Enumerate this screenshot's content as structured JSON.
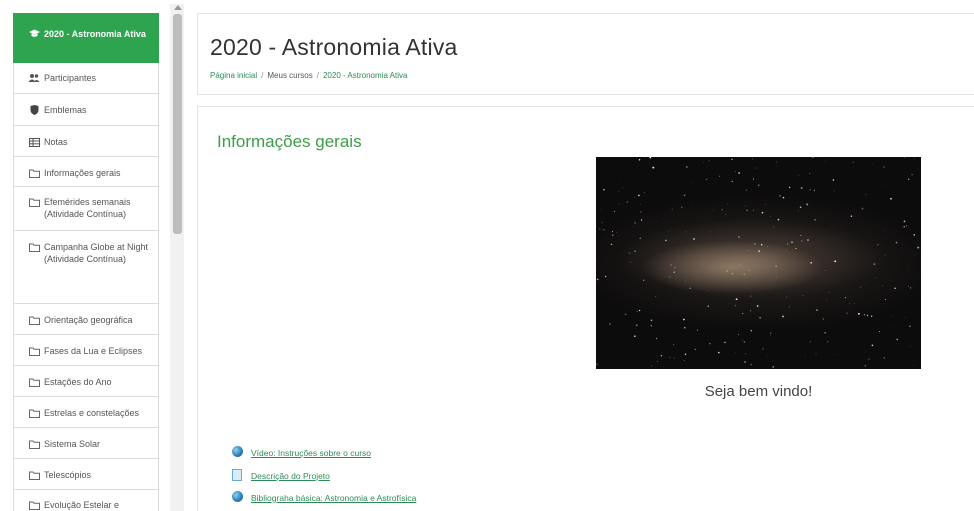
{
  "sidebar": {
    "items": [
      {
        "label": "2020 - Astronomia Ativa",
        "icon": "graduation-cap-icon",
        "active": true
      },
      {
        "label": "Participantes",
        "icon": "users-icon"
      },
      {
        "label": "Emblemas",
        "icon": "shield-icon"
      },
      {
        "label": "Notas",
        "icon": "table-icon"
      },
      {
        "label": "Informações gerais",
        "icon": "folder-icon"
      },
      {
        "label": "Efemérides semanais (Atividade Contínua)",
        "icon": "folder-icon"
      },
      {
        "label": "Campanha Globe at Night (Atividade Contínua)",
        "icon": "folder-icon"
      },
      {
        "label": "Orientação geográfica",
        "icon": "folder-icon"
      },
      {
        "label": "Fases da Lua e Eclipses",
        "icon": "folder-icon"
      },
      {
        "label": "Estações do Ano",
        "icon": "folder-icon"
      },
      {
        "label": "Estrelas e constelações",
        "icon": "folder-icon"
      },
      {
        "label": "Sistema Solar",
        "icon": "folder-icon"
      },
      {
        "label": "Telescópios",
        "icon": "folder-icon"
      },
      {
        "label": "Evolução Estelar e Objetos de Céu",
        "icon": "folder-icon"
      }
    ]
  },
  "header": {
    "title": "2020 - Astronomia Ativa",
    "breadcrumb": [
      "Página inicial",
      "Meus cursos",
      "2020 - Astronomia Ativa"
    ]
  },
  "main": {
    "section_title": "Informações gerais",
    "welcome": "Seja bem vindo!",
    "resources": [
      {
        "label": "Vídeo: Instruções sobre o curso",
        "icon": "url-globe-icon"
      },
      {
        "label": "Descrição do Projeto",
        "icon": "page-icon"
      },
      {
        "label": "Bibliograha básica: Astronomia e Astrofísica",
        "icon": "url-globe-icon"
      }
    ]
  },
  "colors": {
    "accent_green": "#2ea44f",
    "link_green": "#2e8b57",
    "section_green": "#3c9e4a"
  }
}
